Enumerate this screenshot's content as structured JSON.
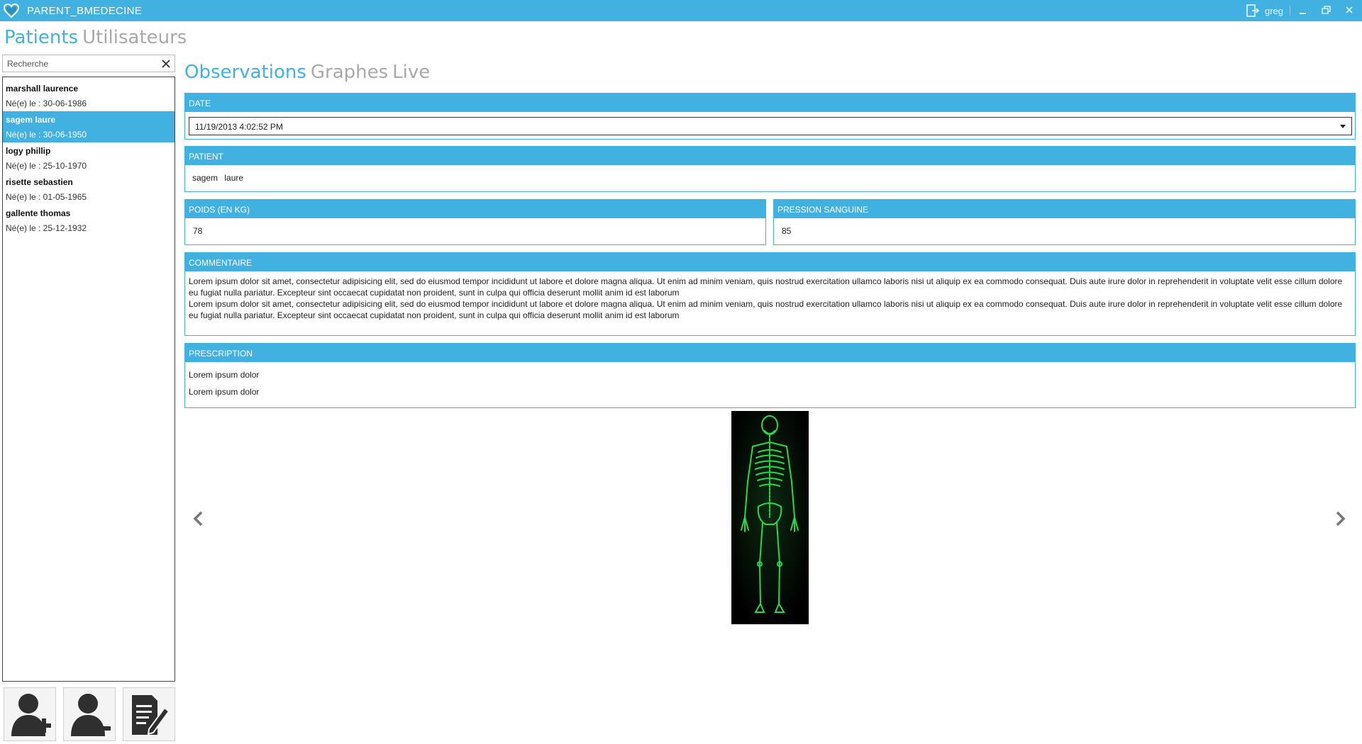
{
  "window": {
    "title": "PARENT_BMEDECINE",
    "user": "greg",
    "accent_color": "#41b1e1"
  },
  "top_nav": {
    "tabs": [
      {
        "label": "Patients",
        "active": true
      },
      {
        "label": "Utilisateurs",
        "active": false
      }
    ]
  },
  "search": {
    "placeholder": "Recherche",
    "value": ""
  },
  "patients": [
    {
      "name": "marshall laurence",
      "birth": "Né(e) le : 30-06-1986",
      "selected": false
    },
    {
      "name": "sagem laure",
      "birth": "Né(e) le : 30-06-1950",
      "selected": true
    },
    {
      "name": "logy phillip",
      "birth": "Né(e) le : 25-10-1970",
      "selected": false
    },
    {
      "name": "risette sebastien",
      "birth": "Né(e) le : 01-05-1965",
      "selected": false
    },
    {
      "name": "gallente thomas",
      "birth": "Né(e) le : 25-12-1932",
      "selected": false
    }
  ],
  "actions": [
    {
      "icon": "add-user-icon"
    },
    {
      "icon": "remove-user-icon"
    },
    {
      "icon": "edit-document-icon"
    }
  ],
  "sub_tabs": [
    {
      "label": "Observations",
      "active": true
    },
    {
      "label": "Graphes",
      "active": false
    },
    {
      "label": "Live",
      "active": false
    }
  ],
  "observation": {
    "date_label": "DATE",
    "date_value": "11/19/2013 4:02:52 PM",
    "patient_label": "PATIENT",
    "patient_first": "sagem",
    "patient_last": "laure",
    "weight_label": "POIDS (EN KG)",
    "weight_value": "78",
    "pressure_label": "PRESSION SANGUINE",
    "pressure_value": "85",
    "comment_label": "COMMENTAIRE",
    "comment_lines": [
      "Lorem ipsum dolor sit amet, consectetur adipisicing elit, sed do eiusmod tempor incididunt ut labore et dolore magna aliqua. Ut enim ad minim veniam, quis nostrud exercitation ullamco laboris nisi ut aliquip ex ea commodo consequat. Duis aute irure dolor in reprehenderit in voluptate velit esse cillum dolore eu fugiat nulla pariatur. Excepteur sint occaecat cupidatat non proident, sunt in culpa qui officia deserunt mollit anim id est laborum",
      "Lorem ipsum dolor sit amet, consectetur adipisicing elit, sed do eiusmod tempor incididunt ut labore et dolore magna aliqua. Ut enim ad minim veniam, quis nostrud exercitation ullamco laboris nisi ut aliquip ex ea commodo consequat. Duis aute irure dolor in reprehenderit in voluptate velit esse cillum dolore eu fugiat nulla pariatur. Excepteur sint occaecat cupidatat non proident, sunt in culpa qui officia deserunt mollit anim id est laborum"
    ],
    "prescription_label": "PRESCRIPTION",
    "prescription_lines": [
      "Lorem ipsum dolor",
      "Lorem ipsum dolor"
    ]
  }
}
